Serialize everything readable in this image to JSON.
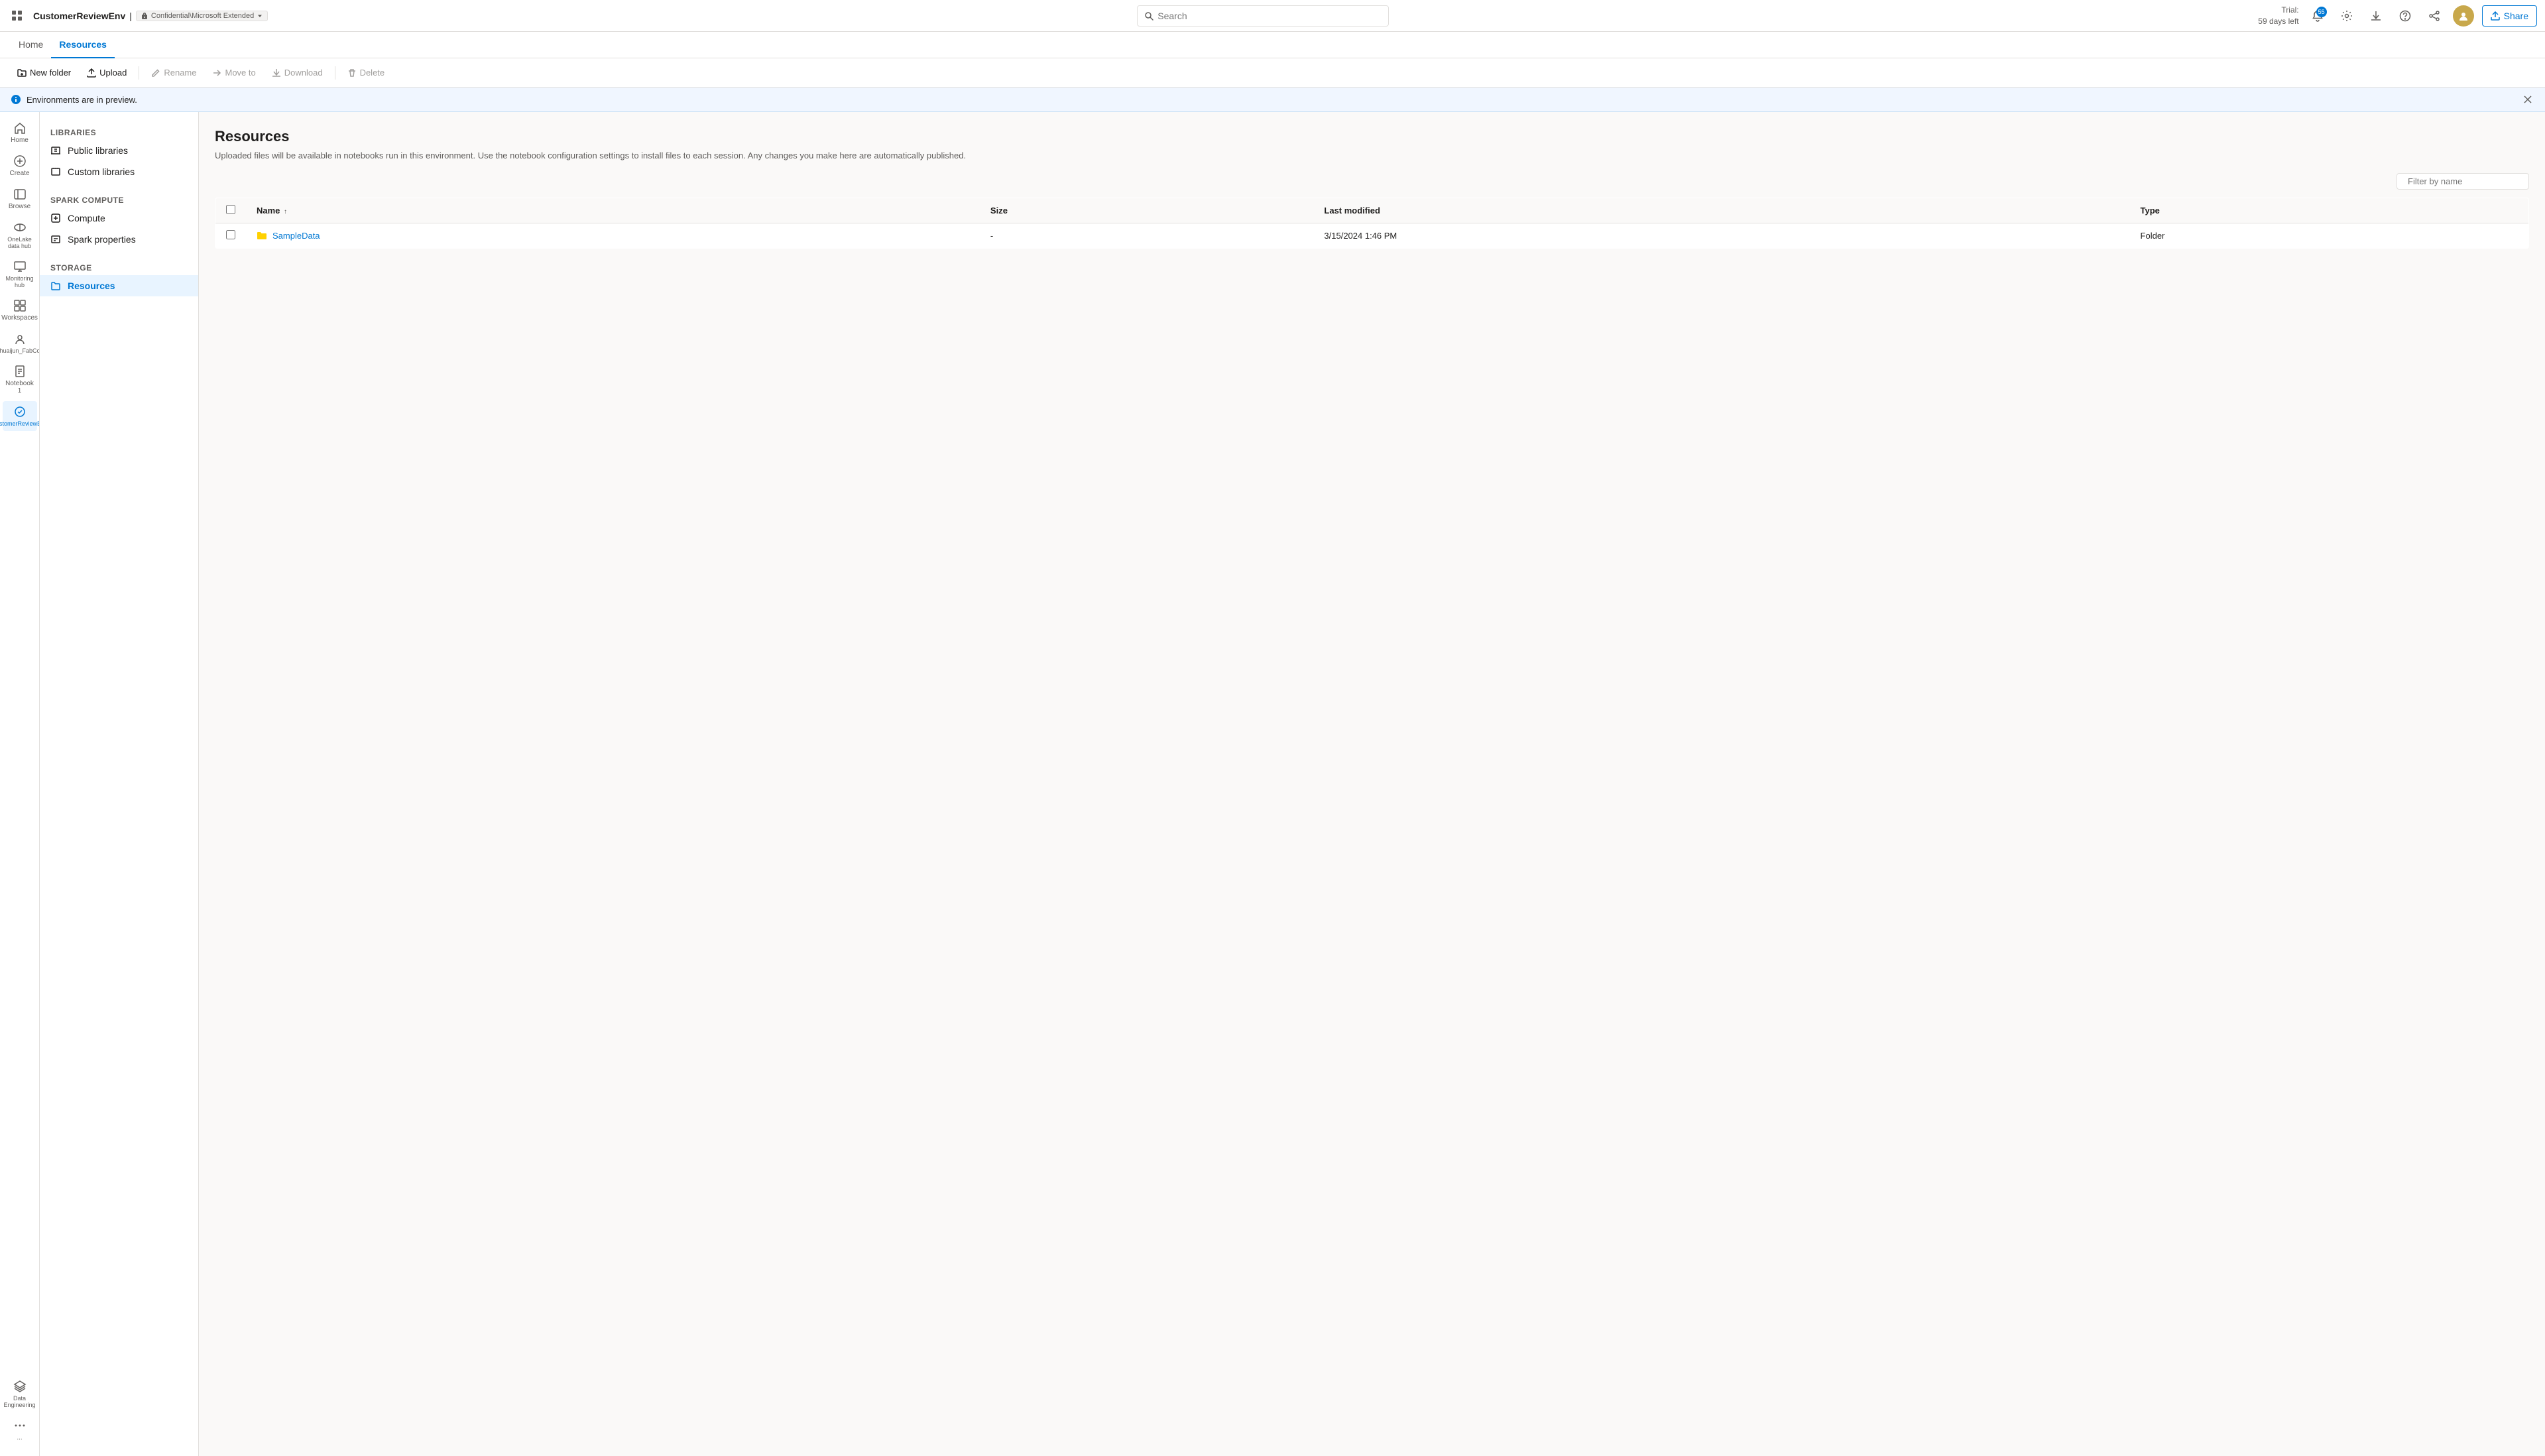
{
  "topbar": {
    "apps_icon": "grid-icon",
    "env_name": "CustomerReviewEnv",
    "badge_text": "Confidential\\Microsoft Extended",
    "search_placeholder": "Search",
    "trial_line1": "Trial:",
    "trial_line2": "59 days left",
    "notification_count": "55",
    "share_label": "Share"
  },
  "subnav": {
    "items": [
      {
        "label": "Home",
        "active": false
      },
      {
        "label": "Resources",
        "active": true
      }
    ]
  },
  "toolbar": {
    "new_folder_label": "New folder",
    "upload_label": "Upload",
    "rename_label": "Rename",
    "move_to_label": "Move to",
    "download_label": "Download",
    "delete_label": "Delete"
  },
  "preview_banner": {
    "message": "Environments are in preview."
  },
  "icon_sidebar": {
    "items": [
      {
        "label": "Home",
        "icon": "home-icon",
        "active": false
      },
      {
        "label": "Create",
        "icon": "plus-icon",
        "active": false
      },
      {
        "label": "Browse",
        "icon": "browse-icon",
        "active": false
      },
      {
        "label": "OneLake data hub",
        "icon": "onelake-icon",
        "active": false
      },
      {
        "label": "Monitoring hub",
        "icon": "monitor-icon",
        "active": false
      },
      {
        "label": "Workspaces",
        "icon": "workspaces-icon",
        "active": false
      },
      {
        "label": "Shuaijun_FabCon",
        "icon": "workspace-icon",
        "active": false
      },
      {
        "label": "Notebook 1",
        "icon": "notebook-icon",
        "active": false
      },
      {
        "label": "CustomerReviewEnv",
        "icon": "env-icon",
        "active": true
      }
    ],
    "bottom_items": [
      {
        "label": "Data Engineering",
        "icon": "de-icon",
        "active": false
      },
      {
        "label": "More",
        "icon": "more-icon",
        "active": false
      }
    ]
  },
  "nav_panel": {
    "libraries_title": "Libraries",
    "libraries_items": [
      {
        "label": "Public libraries",
        "icon": "public-lib-icon"
      },
      {
        "label": "Custom libraries",
        "icon": "custom-lib-icon"
      }
    ],
    "spark_title": "Spark compute",
    "spark_items": [
      {
        "label": "Compute",
        "icon": "compute-icon"
      },
      {
        "label": "Spark properties",
        "icon": "spark-props-icon"
      }
    ],
    "storage_title": "Storage",
    "storage_items": [
      {
        "label": "Resources",
        "icon": "resources-icon",
        "active": true
      }
    ]
  },
  "content": {
    "title": "Resources",
    "description": "Uploaded files will be available in notebooks run in this environment. Use the notebook configuration settings to install files to each session. Any changes you make here are automatically published.",
    "filter_placeholder": "Filter by name",
    "table": {
      "columns": [
        {
          "label": "Name",
          "sort": true
        },
        {
          "label": "Size"
        },
        {
          "label": "Last modified"
        },
        {
          "label": "Type"
        }
      ],
      "rows": [
        {
          "name": "SampleData",
          "size": "-",
          "last_modified": "3/15/2024 1:46 PM",
          "type": "Folder"
        }
      ]
    }
  }
}
